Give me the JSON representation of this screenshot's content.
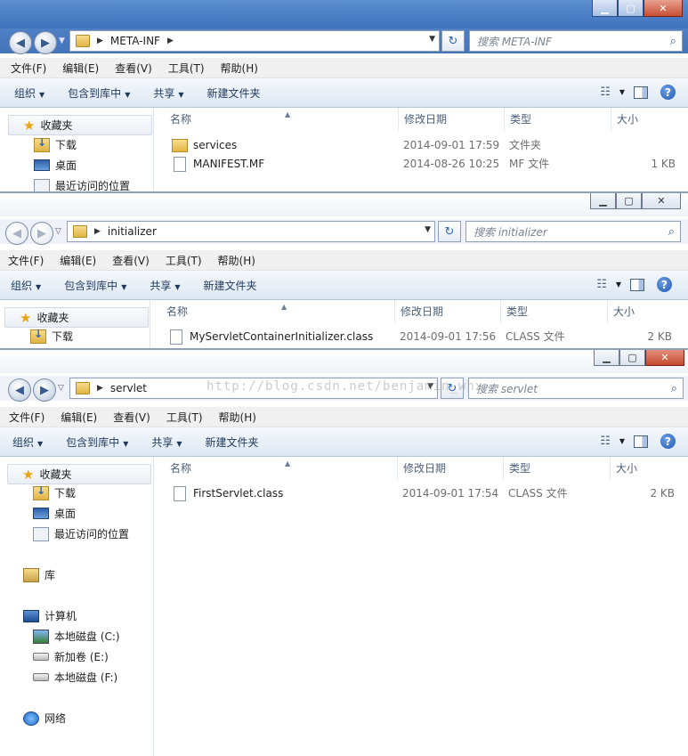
{
  "windows": [
    {
      "address": "META-INF",
      "search_placeholder": "搜索 META-INF",
      "menu": [
        "文件(F)",
        "编辑(E)",
        "查看(V)",
        "工具(T)",
        "帮助(H)"
      ],
      "toolbar": {
        "organize": "组织",
        "include": "包含到库中",
        "share": "共享",
        "new_folder": "新建文件夹"
      },
      "columns": {
        "name": "名称",
        "date": "修改日期",
        "type": "类型",
        "size": "大小"
      },
      "nav": {
        "favorites": "收藏夹",
        "downloads": "下载",
        "desktop": "桌面",
        "recent": "最近访问的位置"
      },
      "files": [
        {
          "name": "services",
          "date": "2014-09-01 17:59",
          "type": "文件夹",
          "size": "",
          "icon": "folder-icon"
        },
        {
          "name": "MANIFEST.MF",
          "date": "2014-08-26 10:25",
          "type": "MF 文件",
          "size": "1 KB",
          "icon": "file-icon"
        }
      ]
    },
    {
      "address": "initializer",
      "search_placeholder": "搜索 initializer",
      "menu": [
        "文件(F)",
        "编辑(E)",
        "查看(V)",
        "工具(T)",
        "帮助(H)"
      ],
      "toolbar": {
        "organize": "组织",
        "include": "包含到库中",
        "share": "共享",
        "new_folder": "新建文件夹"
      },
      "columns": {
        "name": "名称",
        "date": "修改日期",
        "type": "类型",
        "size": "大小"
      },
      "nav": {
        "favorites": "收藏夹",
        "downloads": "下载"
      },
      "files": [
        {
          "name": "MyServletContainerInitializer.class",
          "date": "2014-09-01 17:56",
          "type": "CLASS 文件",
          "size": "2 KB",
          "icon": "file-icon"
        }
      ]
    },
    {
      "address": "servlet",
      "search_placeholder": "搜索 servlet",
      "menu": [
        "文件(F)",
        "编辑(E)",
        "查看(V)",
        "工具(T)",
        "帮助(H)"
      ],
      "toolbar": {
        "organize": "组织",
        "include": "包含到库中",
        "share": "共享",
        "new_folder": "新建文件夹"
      },
      "columns": {
        "name": "名称",
        "date": "修改日期",
        "type": "类型",
        "size": "大小"
      },
      "nav": {
        "favorites": "收藏夹",
        "downloads": "下载",
        "desktop": "桌面",
        "recent": "最近访问的位置",
        "libraries": "库",
        "computer": "计算机",
        "drive_c": "本地磁盘 (C:)",
        "drive_e": "新加卷 (E:)",
        "drive_f": "本地磁盘 (F:)",
        "network": "网络"
      },
      "files": [
        {
          "name": "FirstServlet.class",
          "date": "2014-09-01 17:54",
          "type": "CLASS 文件",
          "size": "2 KB",
          "icon": "file-icon"
        }
      ]
    }
  ],
  "watermark": "http://blog.csdn.net/benjamin_whx"
}
